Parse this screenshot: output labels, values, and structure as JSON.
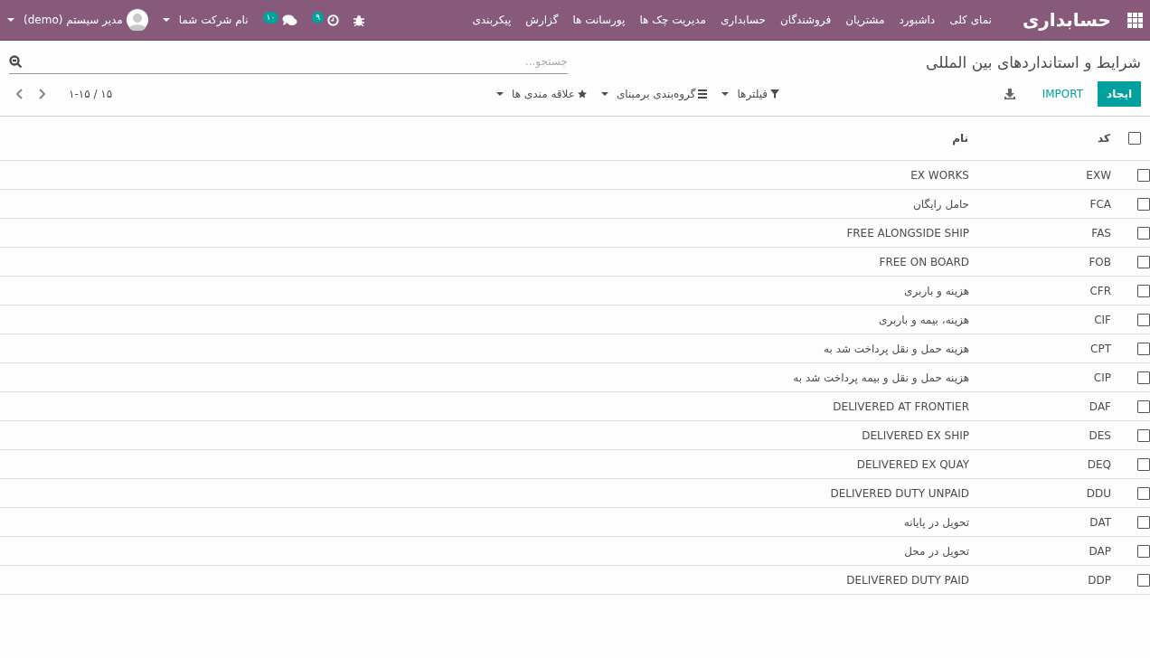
{
  "navbar": {
    "brand": "حسابداری",
    "menu": [
      "نمای کلی",
      "داشبورد",
      "مشتریان",
      "فروشندگان",
      "حسابداری",
      "مدیریت چک ها",
      "پورسانت ها",
      "گزارش",
      "پیکربندی"
    ],
    "activity_badge": "۹",
    "messages_badge": "۱۰",
    "company": "نام شرکت شما",
    "user": "مدیر سیستم (demo)"
  },
  "breadcrumb": "شرایط و استانداردهای بین المللی",
  "search": {
    "placeholder": "جستجو..."
  },
  "buttons": {
    "create": "ایجاد",
    "import": "IMPORT"
  },
  "search_options": [
    "فیلترها",
    "گروه‌بندی برمبنای",
    "علاقه مندی ها"
  ],
  "pager": "۱-۱۵ / ۱۵",
  "table": {
    "select_all": {
      "checked": false
    },
    "columns": [
      "کد",
      "نام"
    ],
    "rows": [
      {
        "code": "EXW",
        "name": "EX WORKS",
        "checked": false
      },
      {
        "code": "FCA",
        "name": "حامل رایگان",
        "checked": false
      },
      {
        "code": "FAS",
        "name": "FREE ALONGSIDE SHIP",
        "checked": false
      },
      {
        "code": "FOB",
        "name": "FREE ON BOARD",
        "checked": false
      },
      {
        "code": "CFR",
        "name": "هزینه و باربری",
        "checked": false
      },
      {
        "code": "CIF",
        "name": "هزینه، بیمه و باربری",
        "checked": false
      },
      {
        "code": "CPT",
        "name": "هزینه حمل و نقل پرداخت شد به",
        "checked": false
      },
      {
        "code": "CIP",
        "name": "هزینه حمل و نقل و بیمه پرداخت شد به",
        "checked": false
      },
      {
        "code": "DAF",
        "name": "DELIVERED AT FRONTIER",
        "checked": false
      },
      {
        "code": "DES",
        "name": "DELIVERED EX SHIP",
        "checked": false
      },
      {
        "code": "DEQ",
        "name": "DELIVERED EX QUAY",
        "checked": false
      },
      {
        "code": "DDU",
        "name": "DELIVERED DUTY UNPAID",
        "checked": false
      },
      {
        "code": "DAT",
        "name": "تحویل در پایانه",
        "checked": false
      },
      {
        "code": "DAP",
        "name": "تحویل در محل",
        "checked": false
      },
      {
        "code": "DDP",
        "name": "DELIVERED DUTY PAID",
        "checked": false
      }
    ]
  }
}
